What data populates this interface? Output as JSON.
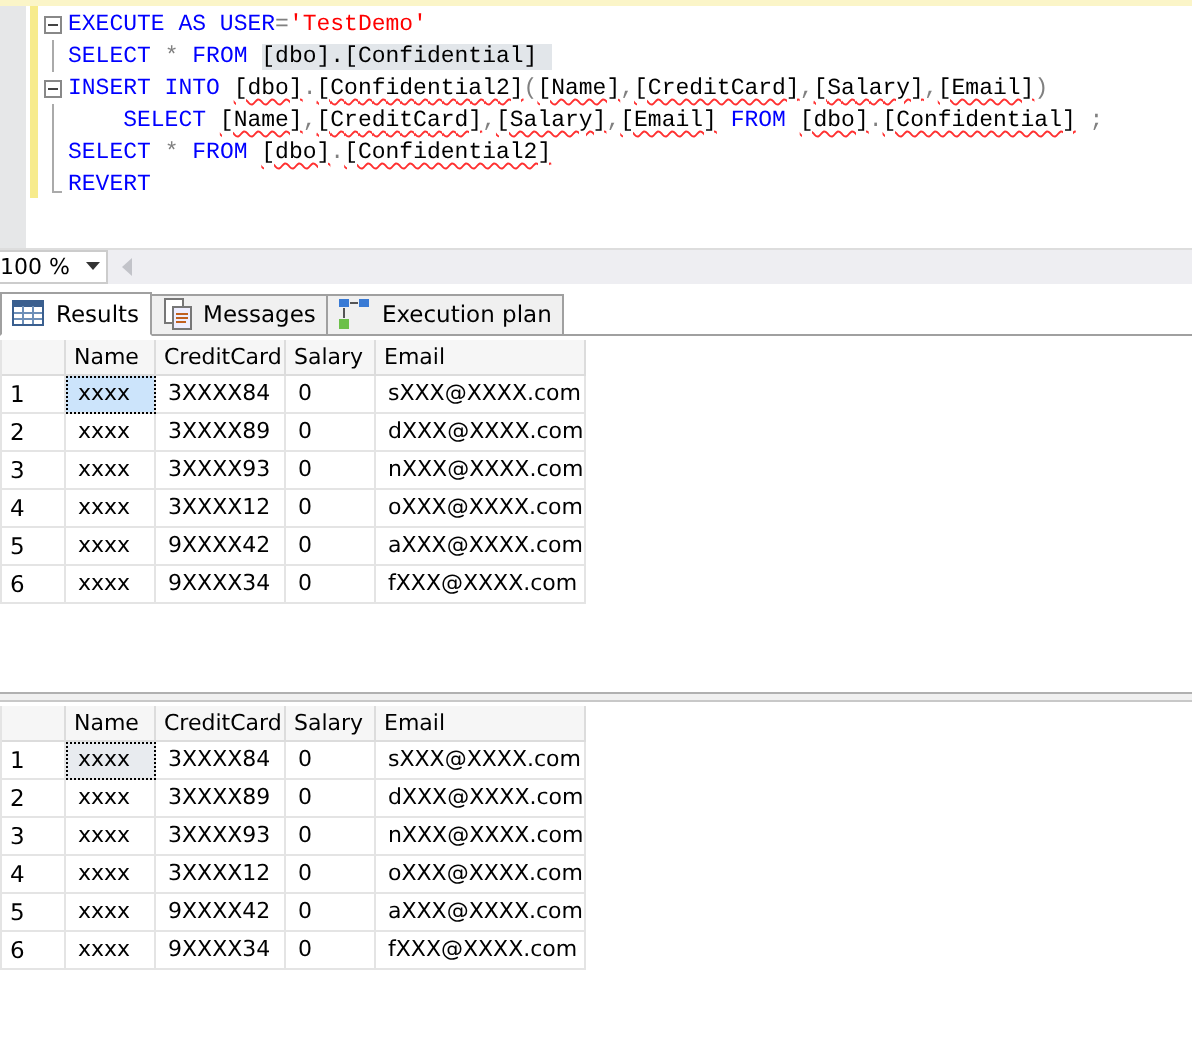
{
  "editor": {
    "lines": [
      {
        "kind": "block-start",
        "tokens": [
          {
            "text": "EXECUTE AS USER",
            "kind": "keyword"
          },
          {
            "text": "=",
            "kind": "operator"
          },
          {
            "text": "'TestDemo'",
            "kind": "string"
          }
        ]
      },
      {
        "kind": "block-line",
        "tokens": [
          {
            "text": "SELECT",
            "kind": "keyword"
          },
          {
            "text": " * ",
            "kind": "operator"
          },
          {
            "text": "FROM ",
            "kind": "keyword"
          },
          {
            "text": "[dbo].[Confidential] ",
            "kind": "plain",
            "highlight": true
          }
        ]
      },
      {
        "kind": "block-start",
        "tokens": [
          {
            "text": "INSERT INTO ",
            "kind": "keyword"
          },
          {
            "text": "[dbo]",
            "kind": "plain",
            "squiggle": true
          },
          {
            "text": ".",
            "kind": "operator"
          },
          {
            "text": "[Confidential2]",
            "kind": "plain",
            "squiggle": true
          },
          {
            "text": "(",
            "kind": "operator"
          },
          {
            "text": "[Name]",
            "kind": "plain",
            "squiggle": true
          },
          {
            "text": ",",
            "kind": "operator"
          },
          {
            "text": "[CreditCard]",
            "kind": "plain",
            "squiggle": true
          },
          {
            "text": ",",
            "kind": "operator"
          },
          {
            "text": "[Salary]",
            "kind": "plain",
            "squiggle": true
          },
          {
            "text": ",",
            "kind": "operator"
          },
          {
            "text": "[Email]",
            "kind": "plain",
            "squiggle": true
          },
          {
            "text": ")",
            "kind": "operator"
          }
        ]
      },
      {
        "kind": "block-line",
        "tokens": [
          {
            "text": "    SELECT ",
            "kind": "keyword"
          },
          {
            "text": "[Name]",
            "kind": "plain",
            "squiggle": true
          },
          {
            "text": ",",
            "kind": "operator"
          },
          {
            "text": "[CreditCard]",
            "kind": "plain",
            "squiggle": true
          },
          {
            "text": ",",
            "kind": "operator"
          },
          {
            "text": "[Salary]",
            "kind": "plain",
            "squiggle": true
          },
          {
            "text": ",",
            "kind": "operator"
          },
          {
            "text": "[Email]",
            "kind": "plain",
            "squiggle": true
          },
          {
            "text": " FROM ",
            "kind": "keyword"
          },
          {
            "text": "[dbo]",
            "kind": "plain",
            "squiggle": true
          },
          {
            "text": ".",
            "kind": "operator"
          },
          {
            "text": "[Confidential]",
            "kind": "plain",
            "squiggle": true
          },
          {
            "text": " ;",
            "kind": "operator"
          }
        ]
      },
      {
        "kind": "block-line",
        "tokens": [
          {
            "text": "SELECT",
            "kind": "keyword"
          },
          {
            "text": " * ",
            "kind": "operator"
          },
          {
            "text": "FROM ",
            "kind": "keyword"
          },
          {
            "text": "[dbo]",
            "kind": "plain",
            "squiggle": true
          },
          {
            "text": ".",
            "kind": "operator"
          },
          {
            "text": "[Confidential2]",
            "kind": "plain",
            "squiggle": true
          }
        ]
      },
      {
        "kind": "block-end",
        "tokens": [
          {
            "text": "REVERT",
            "kind": "keyword"
          }
        ]
      }
    ]
  },
  "zoom": {
    "value": "100 %"
  },
  "tabs": [
    {
      "label": "Results",
      "selected": true
    },
    {
      "label": "Messages",
      "selected": false
    },
    {
      "label": "Execution plan",
      "selected": false
    }
  ],
  "grids": [
    {
      "active": true,
      "columns": [
        "Name",
        "CreditCard",
        "Salary",
        "Email"
      ],
      "rows": [
        {
          "number": "1",
          "cells": [
            {
              "text": "xxxx",
              "selected": true
            },
            {
              "text": "3XXXX84",
              "selected": false
            },
            {
              "text": "0",
              "selected": false
            },
            {
              "text": "sXXX@XXXX.com",
              "selected": false
            }
          ]
        },
        {
          "number": "2",
          "cells": [
            {
              "text": "xxxx",
              "selected": false
            },
            {
              "text": "3XXXX89",
              "selected": false
            },
            {
              "text": "0",
              "selected": false
            },
            {
              "text": "dXXX@XXXX.com",
              "selected": false
            }
          ]
        },
        {
          "number": "3",
          "cells": [
            {
              "text": "xxxx",
              "selected": false
            },
            {
              "text": "3XXXX93",
              "selected": false
            },
            {
              "text": "0",
              "selected": false
            },
            {
              "text": "nXXX@XXXX.com",
              "selected": false
            }
          ]
        },
        {
          "number": "4",
          "cells": [
            {
              "text": "xxxx",
              "selected": false
            },
            {
              "text": "3XXXX12",
              "selected": false
            },
            {
              "text": "0",
              "selected": false
            },
            {
              "text": "oXXX@XXXX.com",
              "selected": false
            }
          ]
        },
        {
          "number": "5",
          "cells": [
            {
              "text": "xxxx",
              "selected": false
            },
            {
              "text": "9XXXX42",
              "selected": false
            },
            {
              "text": "0",
              "selected": false
            },
            {
              "text": "aXXX@XXXX.com",
              "selected": false
            }
          ]
        },
        {
          "number": "6",
          "cells": [
            {
              "text": "xxxx",
              "selected": false
            },
            {
              "text": "9XXXX34",
              "selected": false
            },
            {
              "text": "0",
              "selected": false
            },
            {
              "text": "fXXX@XXXX.com",
              "selected": false
            }
          ]
        }
      ]
    },
    {
      "active": false,
      "columns": [
        "Name",
        "CreditCard",
        "Salary",
        "Email"
      ],
      "rows": [
        {
          "number": "1",
          "cells": [
            {
              "text": "xxxx",
              "selected": true
            },
            {
              "text": "3XXXX84",
              "selected": false
            },
            {
              "text": "0",
              "selected": false
            },
            {
              "text": "sXXX@XXXX.com",
              "selected": false
            }
          ]
        },
        {
          "number": "2",
          "cells": [
            {
              "text": "xxxx",
              "selected": false
            },
            {
              "text": "3XXXX89",
              "selected": false
            },
            {
              "text": "0",
              "selected": false
            },
            {
              "text": "dXXX@XXXX.com",
              "selected": false
            }
          ]
        },
        {
          "number": "3",
          "cells": [
            {
              "text": "xxxx",
              "selected": false
            },
            {
              "text": "3XXXX93",
              "selected": false
            },
            {
              "text": "0",
              "selected": false
            },
            {
              "text": "nXXX@XXXX.com",
              "selected": false
            }
          ]
        },
        {
          "number": "4",
          "cells": [
            {
              "text": "xxxx",
              "selected": false
            },
            {
              "text": "3XXXX12",
              "selected": false
            },
            {
              "text": "0",
              "selected": false
            },
            {
              "text": "oXXX@XXXX.com",
              "selected": false
            }
          ]
        },
        {
          "number": "5",
          "cells": [
            {
              "text": "xxxx",
              "selected": false
            },
            {
              "text": "9XXXX42",
              "selected": false
            },
            {
              "text": "0",
              "selected": false
            },
            {
              "text": "aXXX@XXXX.com",
              "selected": false
            }
          ]
        },
        {
          "number": "6",
          "cells": [
            {
              "text": "xxxx",
              "selected": false
            },
            {
              "text": "9XXXX34",
              "selected": false
            },
            {
              "text": "0",
              "selected": false
            },
            {
              "text": "fXXX@XXXX.com",
              "selected": false
            }
          ]
        }
      ]
    }
  ]
}
